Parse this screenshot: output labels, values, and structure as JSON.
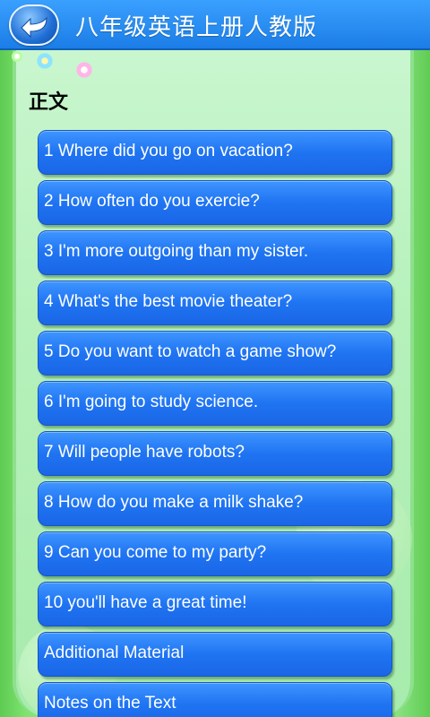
{
  "app": {
    "title": "八年级英语上册人教版"
  },
  "section": {
    "label": "正文"
  },
  "items": [
    {
      "label": "1 Where did you go on vacation?"
    },
    {
      "label": "2 How often do you exercie?"
    },
    {
      "label": "3 I'm more outgoing than my sister."
    },
    {
      "label": "4 What's the best movie theater?"
    },
    {
      "label": "5 Do you want to watch a game show?"
    },
    {
      "label": "6 I'm going to study science."
    },
    {
      "label": "7 Will people have robots?"
    },
    {
      "label": "8 How do you make a milk shake?"
    },
    {
      "label": "9 Can you come to my party?"
    },
    {
      "label": "10 you'll have a great time!"
    },
    {
      "label": "Additional Material"
    },
    {
      "label": "Notes on the Text"
    }
  ],
  "icons": {
    "back": "back-arrow-icon"
  },
  "colors": {
    "header": "#1b7de6",
    "button": "#1f74f2",
    "background": "#b6f1bb"
  }
}
